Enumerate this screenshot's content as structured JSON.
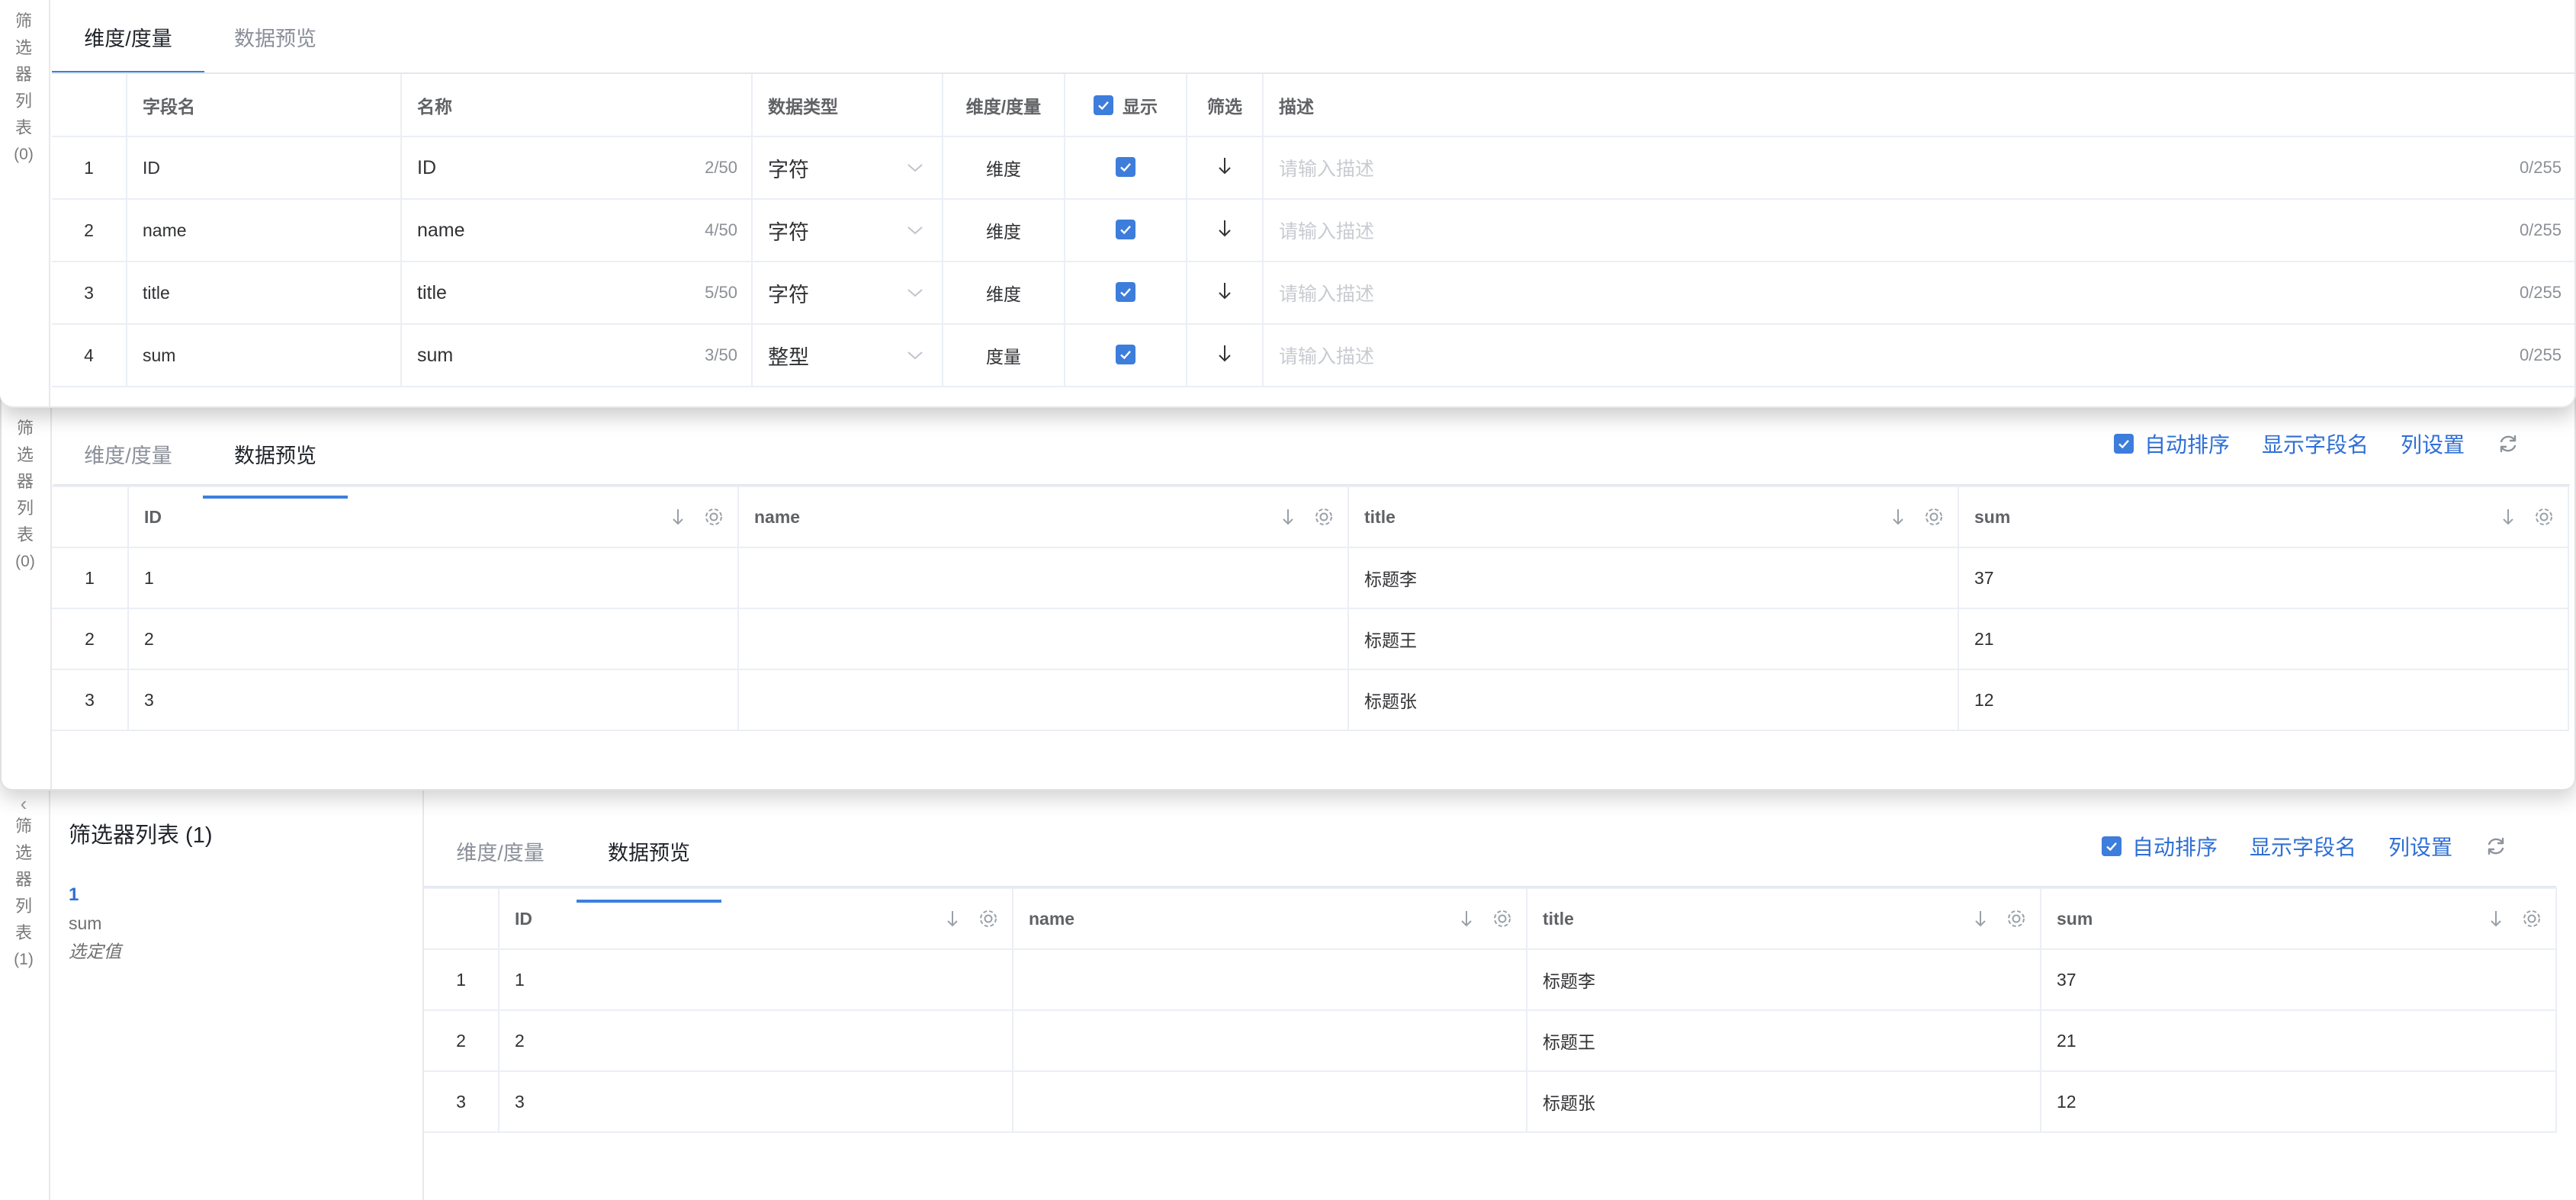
{
  "side_tab": {
    "chars": [
      "筛",
      "选",
      "器",
      "列",
      "表"
    ],
    "count_panel1": "(0)",
    "count_panel2": "(0)",
    "count_panel3": "(1)"
  },
  "tabs": {
    "dimension": "维度/度量",
    "preview": "数据预览"
  },
  "toolbar": {
    "auto_sort": "自动排序",
    "show_field_name": "显示字段名",
    "column_settings": "列设置"
  },
  "schema": {
    "headers": {
      "field": "字段名",
      "name": "名称",
      "type": "数据类型",
      "dim": "维度/度量",
      "show": "显示",
      "filter": "筛选",
      "desc": "描述"
    },
    "desc_placeholder": "请输入描述",
    "rows": [
      {
        "idx": "1",
        "field": "ID",
        "name": "ID",
        "name_count": "2/50",
        "type": "字符",
        "dim": "维度",
        "desc_count": "0/255"
      },
      {
        "idx": "2",
        "field": "name",
        "name": "name",
        "name_count": "4/50",
        "type": "字符",
        "dim": "维度",
        "desc_count": "0/255"
      },
      {
        "idx": "3",
        "field": "title",
        "name": "title",
        "name_count": "5/50",
        "type": "字符",
        "dim": "维度",
        "desc_count": "0/255"
      },
      {
        "idx": "4",
        "field": "sum",
        "name": "sum",
        "name_count": "3/50",
        "type": "整型",
        "dim": "度量",
        "desc_count": "0/255"
      }
    ]
  },
  "preview": {
    "headers": [
      "ID",
      "name",
      "title",
      "sum"
    ],
    "rows": [
      {
        "idx": "1",
        "id": "1",
        "name": "",
        "title": "标题李",
        "sum": "37"
      },
      {
        "idx": "2",
        "id": "2",
        "name": "",
        "title": "标题王",
        "sum": "21"
      },
      {
        "idx": "3",
        "id": "3",
        "name": "",
        "title": "标题张",
        "sum": "12"
      }
    ]
  },
  "filter_list": {
    "title": "筛选器列表 (1)",
    "item_number": "1",
    "item_field": "sum",
    "item_selection": "选定值"
  },
  "colors": {
    "accent": "#3b7fe0",
    "link": "#2f6fd6",
    "placeholder": "#c8cbd1",
    "border": "#ebeef5"
  }
}
